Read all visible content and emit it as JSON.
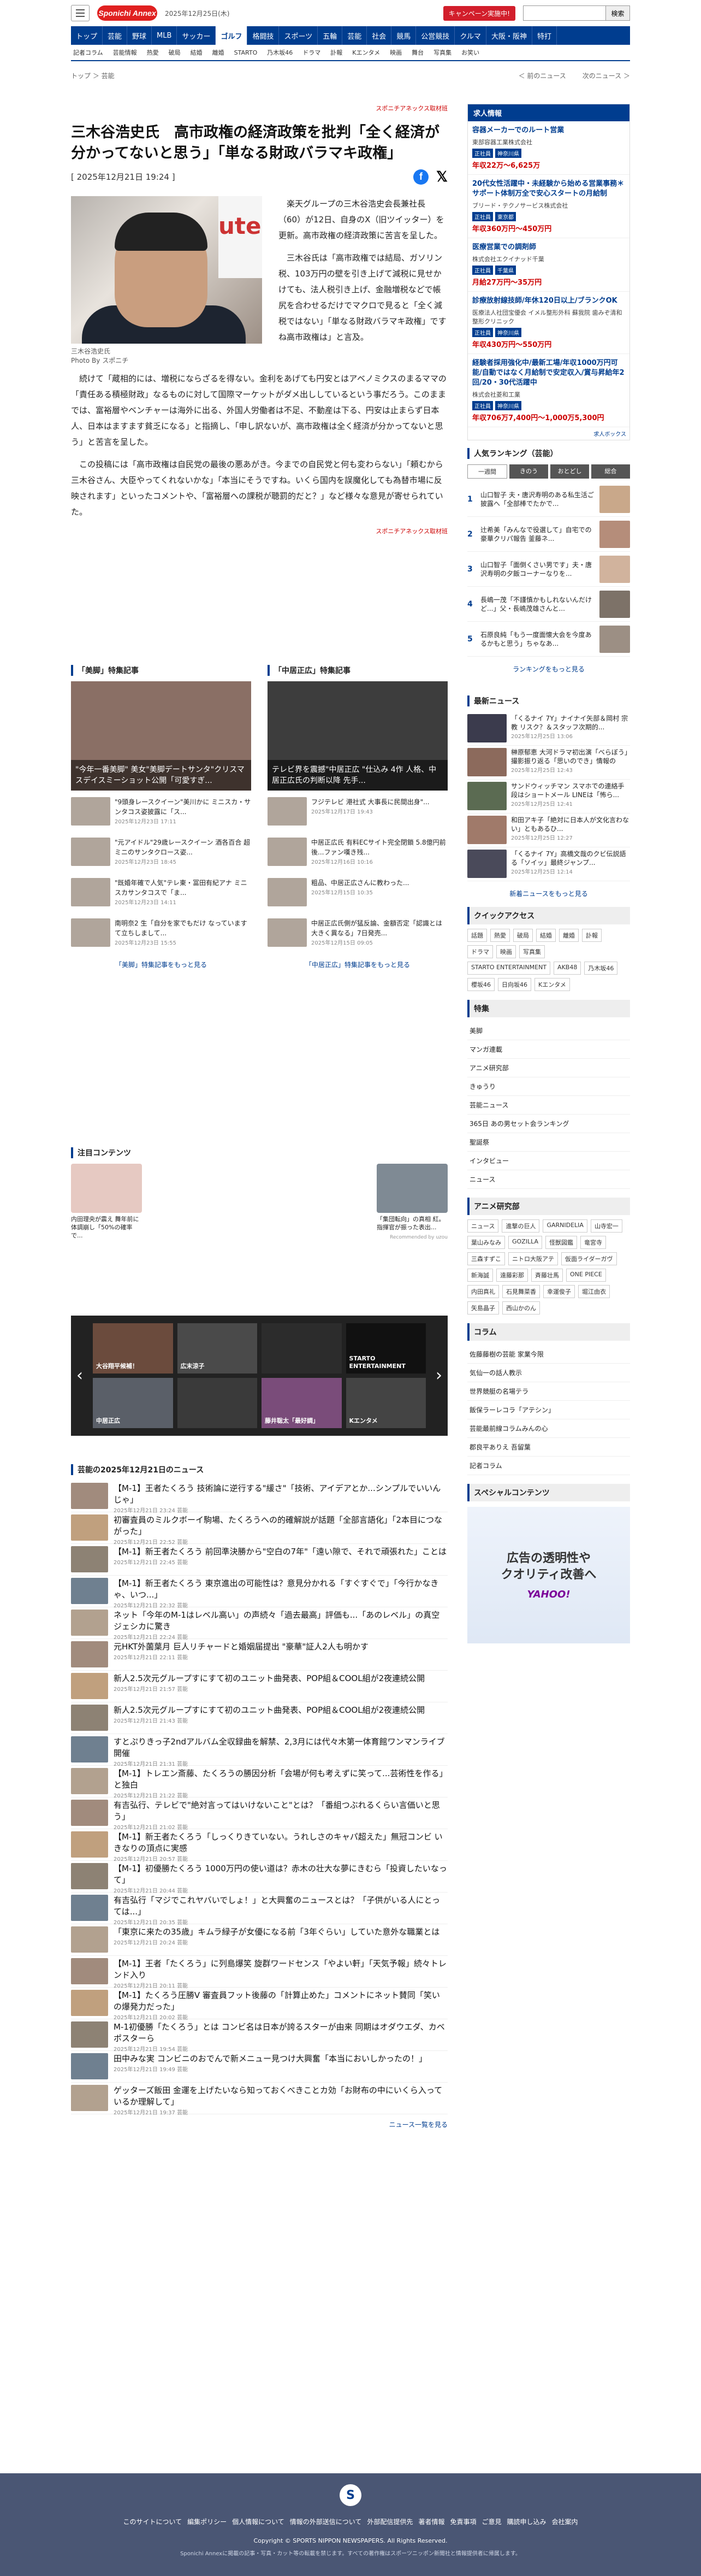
{
  "header": {
    "date": "2025年12月25日(木)",
    "campaign": "キャンペーン実施中!",
    "search_placeholder": "",
    "search_button": "検索",
    "logo": "Sponichi Annex"
  },
  "gnav": [
    "トップ",
    "芸能",
    "野球",
    "MLB",
    "サッカー",
    "ゴルフ",
    "格闘技",
    "スポーツ",
    "五輪",
    "芸能",
    "社会",
    "競馬",
    "公営競技",
    "クルマ",
    "大阪・阪神",
    "特打"
  ],
  "gnav_active": 5,
  "subnav": [
    "記者コラム",
    "芸能情報",
    "热愛",
    "破局",
    "結婚",
    "離婚",
    "STARTO",
    "乃木坂46",
    "ドラマ",
    "訃報",
    "Kエンタメ",
    "映画",
    "舞台",
    "写真集",
    "お笑い"
  ],
  "breadcrumb": "トップ ＞ 芸能",
  "pager": {
    "prev": "＜ 前のニュース",
    "next": "次のニュース ＞"
  },
  "article": {
    "pr_label": "スポニチアネックス取材班",
    "title": "三木谷浩史氏　高市政権の経済政策を批判「全く経済が分かってないと思う」「単なる財政バラマキ政権」",
    "date": "[ 2025年12月21日 19:24 ]",
    "photo_caption": "三木谷浩史氏\nPhoto By スポニチ",
    "p1": "楽天グループの三木谷浩史会長兼社長（60）が12日、自身のX（旧ツイッター）を更新。高市政権の経済政策に苦言を呈した。",
    "p2": "三木谷氏は「高市政権では結局、ガソリン税、103万円の壁を引き上げて減税に見せかけても、法人税引き上げ、金融増税などで帳尻を合わせるだけでマクロで見ると「全く減税ではない」「単なる財政バラマキ政権」ですね高市政権は」と言及。",
    "p3": "続けて「蔵相的には、増税にならざるを得ない。金利をあげても円安とはアベノミクスのまるママの「責任ある積極財政」なるものに対して国際マーケットがダメ出ししているという事だろう。このままでは、富裕層やベンチャーは海外に出る、外国人労働者は不足、不動産は下る、円安は止まらず日本人、日本はますます貧乏になる」と指摘し、「申し訳ないが、高市政権は全く経済が分かってないと思う」と苦言を呈した。",
    "p4": "この投稿には「高市政権は自民党の最後の悪あがき。今までの自民党と何も変わらない」「頼むから三木谷さん、大臣やってくれないかな」「本当にそうですね。いくら国内を誤魔化しても為替市場に反映されます」といったコメントや、「富裕層への課税が聴罰的だと？」など様々な意見が寄せられていた。",
    "pr_label2": "スポニチアネックス取材班"
  },
  "specials": [
    {
      "title": "「美脚」特集記事",
      "hero": "\"今年一番美脚\" 美女\"美脚デートサンタ\"クリスマスデイスミーショット公開「可愛すぎ...",
      "hero_date": "2025年12月24日 14:13",
      "items": [
        {
          "t": "\"9頭身レースクイーン\"美川かに ミニスカ・サンタコス姿披露に「ス...",
          "d": "2025年12月23日 17:11"
        },
        {
          "t": "\"元アイドル\"29歳レースクイーン 酒各百合 超ミニのサンタクロース姿...",
          "d": "2025年12月23日 18:45"
        },
        {
          "t": "\"既婚年確で人気\"テレ東・冨田有紀アナ ミニスカサンタコスで「ま...",
          "d": "2025年12月23日 14:11"
        },
        {
          "t": "南明奈2 生「自分を家でもだけ なっていますて立ちしまして...",
          "d": "2025年12月23日 15:55"
        }
      ],
      "more": "「美脚」特集記事をもっと見る"
    },
    {
      "title": "「中居正広」特集記事",
      "hero": "テレビ界を震撼\"中居正広 \"仕込み 4作 人格、中居正広氏の判断以降 先手...",
      "hero_date": "2025年12月21日 06:43",
      "items": [
        {
          "t": "フジテレビ 港社式 大事長に民間出身\"...",
          "d": "2025年12月17日 19:43"
        },
        {
          "t": "中居正広氏 有料ECサイト完全閉鎖 5.8億円前後...ファン嘆き残...",
          "d": "2025年12月16日 10:16"
        },
        {
          "t": "粗品、中居正広さんに教わった...",
          "d": "2025年12月15日 10:35"
        },
        {
          "t": "中居正広氏側が猛反論、金額否定「認識とは大きく異なる」7日発売...",
          "d": "2025年12月15日 09:05"
        }
      ],
      "more": "「中居正広」特集記事をもっと見る"
    }
  ],
  "attention": {
    "title": "注目コンテンツ",
    "items": [
      {
        "t": "内田理央が震え 舞年前に体調崩し「50%の確率で..."
      },
      {
        "t": ""
      },
      {
        "t": ""
      },
      {
        "t": ""
      },
      {
        "t": "「集団転向」の真相 紅。指揮官が振った表出...",
        "r": "Recommended by uzou"
      }
    ]
  },
  "carousel": {
    "cells": [
      "大谷翔平候補！",
      "広末涼子",
      "",
      "STARTO ENTERTAINMENT",
      "中居正広",
      "",
      "藤井聡太「最好調」",
      "Kエンタメ"
    ]
  },
  "newslist": {
    "title": "芸能の2025年12月21日のニュース",
    "items": [
      {
        "t": "【M-1】王者たくろう 技術論に逆行する\"緩さ\"「技術、アイデアとか...シンプルでいいんじゃ」",
        "d": "2025年12月21日 23:24 芸能"
      },
      {
        "t": "初審査員のミルクボーイ駒場、たくろうへの的確解説が話題「全部言語化」「2本目につながった」",
        "d": "2025年12月21日 22:52 芸能"
      },
      {
        "t": "【M-1】新王者たくろう 前回準決勝から\"空白の7年\"「遠い隙で、それで頑張れた」ことは",
        "d": "2025年12月21日 22:45 芸能"
      },
      {
        "t": "【M-1】新王者たくろう 東京進出の可能性は？意見分かれる「すぐすぐで」「今行かなきゃ、いつ...」",
        "d": "2025年12月21日 22:32 芸能"
      },
      {
        "t": "ネット「今年のM-1はレベル高い」の声続々「過去最高」評価も...「あのレベル」の真空ジェシカに驚き",
        "d": "2025年12月21日 22:24 芸能"
      },
      {
        "t": "元HKT外薗葉月 巨人リチャードと婚姻届提出 \"豪華\"証人2人も明かす",
        "d": "2025年12月21日 22:11 芸能"
      },
      {
        "t": "新人2.5次元グループすにすて初のユニット曲発表、POP組＆COOL組が2夜連続公開",
        "d": "2025年12月21日 21:57 芸能"
      },
      {
        "t": "新人2.5次元グループすにすて初のユニット曲発表、POP組＆COOL組が2夜連続公開",
        "d": "2025年12月21日 21:43 芸能"
      },
      {
        "t": "すとぷりきっ子2ndアルバム全収録曲を解禁、2,3月には代々木第一体育館ワンマンライブ開催",
        "d": "2025年12月21日 21:31 芸能"
      },
      {
        "t": "【M-1】トレエン斎藤、たくろうの勝因分析「会場が何も考えずに笑って...芸術性を作る」と独白",
        "d": "2025年12月21日 21:22 芸能"
      },
      {
        "t": "有吉弘行、テレビで\"絶対言ってはいけないこと\"とは？「番組つぶれるくらい言価いと思う」",
        "d": "2025年12月21日 21:02 芸能"
      },
      {
        "t": "【M-1】新王者たくろう「しっくりきていない。うれしさのキャパ超えた」無冠コンビ いきなりの頂点に実感",
        "d": "2025年12月21日 20:57 芸能"
      },
      {
        "t": "【M-1】初優勝たくろう 1000万円の使い道は？赤木の壮大な夢にきむら「投資したいなって」",
        "d": "2025年12月21日 20:44 芸能"
      },
      {
        "t": "有吉弘行「マジでこれヤバいでしょ！」と大興奮のニュースとは？「子供がいる人にとっては...」",
        "d": "2025年12月21日 20:35 芸能"
      },
      {
        "t": "「東京に来たの35歳」キムラ緑子が女優になる前「3年ぐらい」していた意外な職業とは",
        "d": "2025年12月21日 20:24 芸能"
      },
      {
        "t": "【M-1】王者「たくろう」に列島爆笑 旋群ワードセンス「やよい軒」「天気予報」続々トレンド入り",
        "d": "2025年12月21日 20:11 芸能"
      },
      {
        "t": "【M-1】たくろう圧勝V 審査員フット後藤の「計算止めた」コメントにネット賛同「笑いの爆発力だった」",
        "d": "2025年12月21日 20:02 芸能"
      },
      {
        "t": "M-1初優勝「たくろう」とは コンビ名は日本が誇るスターが由来 同期はオダウエダ、カベポスターら",
        "d": "2025年12月21日 19:54 芸能"
      },
      {
        "t": "田中みな実 コンビニのおでんで新メニュー見つけ大興奮「本当においしかったの！」",
        "d": "2025年12月21日 19:49 芸能"
      },
      {
        "t": "ゲッターズ飯田 金運を上げたいなら知っておくべきことカ効「お財布の中にいくら入っているか理解して」",
        "d": "2025年12月21日 19:37 芸能"
      }
    ],
    "more": "ニュース一覧を見る"
  },
  "side": {
    "jobs_title": "求人情報",
    "jobs": [
      {
        "t": "容器メーカーでのルート営業",
        "c": "東部容器工業株式会社",
        "tags": [
          "正社員",
          "神奈川県"
        ],
        "p": "年収22万～6,625万"
      },
      {
        "t": "20代女性活躍中・未経験から始める営業事務＊サポート体制万全で安心スタートの月給制",
        "c": "ブリード・テクノサービス株式会社",
        "tags": [
          "正社員",
          "東京都"
        ],
        "p": "年収360万円～450万円"
      },
      {
        "t": "医療営業での調剤師",
        "c": "株式会社エクイナッド千葉",
        "tags": [
          "正社員",
          "千葉県"
        ],
        "p": "月給27万円～35万円"
      },
      {
        "t": "診療放射線技師/年休120日以上/ブランクOK",
        "c": "医療法人社団宝優会 イメル整形外科 蘇我院 歯みぞ清和整形クリニック",
        "tags": [
          "正社員",
          "神奈川県"
        ],
        "p": "年収430万円～550万円"
      },
      {
        "t": "経験者採用強化中/最新工場/年収1000万円可能/自動ではなく月給制で安定収入/賞与昇給年2回/20・30代活躍中",
        "c": "株式会社菱和工業",
        "tags": [
          "正社員",
          "神奈川県"
        ],
        "p": "年収706万7,400円～1,000万5,300円"
      }
    ],
    "jobs_footer": "求人ボックス",
    "ranking_title": "人気ランキング（芸能）",
    "ranking_tabs": [
      "一週間",
      "きのう",
      "おとどし",
      "総合"
    ],
    "ranking": [
      {
        "n": "1",
        "t": "山口智子 夫・唐沢寿明のある私生活ご披露へ「全部棒でたかで..."
      },
      {
        "n": "2",
        "t": "辻希美「みんなで役選して」自宅での豪華クリパ報告 釜藤ネ..."
      },
      {
        "n": "3",
        "t": "山口智子「面倒くさい男です」夫・唐沢寿明の夕飯コーナーなりを..."
      },
      {
        "n": "4",
        "t": "長嶋一茂「不謹慎かもしれないんだけど...」父・長嶋茂雄さんと..."
      },
      {
        "n": "5",
        "t": "石原良純「もう一度面懐大会を今度あるかもと思う」ちゃなあ..."
      }
    ],
    "ranking_more": "ランキングをもっと見る",
    "latest_title": "最新ニュース",
    "latest": [
      {
        "t": "「くるナイ 7Y」ナイナイ矢部＆岡村 宗教 リスク？＆スタッフ次期的...",
        "d": "2025年12月25日 13:06"
      },
      {
        "t": "榊原郁恵 大河ドラマ初出演「べらぼう」撮影振り返る「思いのでき」情報の",
        "d": "2025年12月25日 12:43"
      },
      {
        "t": "サンドウィッチマン スマホでの連絡手段はショートメール LINEは「怖ら...",
        "d": "2025年12月25日 12:41"
      },
      {
        "t": "和田アキ子「絶対に日本人が文化言わない」ともあるひ...",
        "d": "2025年12月25日 12:27"
      },
      {
        "t": "「くるナイ 7Y」高橋文哉のクビ伝説語る「ソイッ」最終ジャンプ...",
        "d": "2025年12月25日 12:14"
      }
    ],
    "latest_more": "新着ニュースをもっと見る",
    "quick_title": "クイックアクセス",
    "quick": [
      "話題",
      "熱愛",
      "破局",
      "結婚",
      "離婚",
      "訃報",
      "ドラマ",
      "映画",
      "写真集",
      "STARTO ENTERTAINMENT",
      "AKB48",
      "乃木坂46",
      "櫻坂46",
      "日向坂46",
      "Kエンタメ"
    ],
    "feature_title": "特集",
    "feature": [
      "美脚",
      "マンガ連載",
      "アニメ研究部",
      "きゅうり",
      "芸能ニュース",
      "365日 あの男セット会ランキング",
      "聖誕祭",
      "インタビュー",
      "ニュース"
    ],
    "anime_title": "アニメ研究部",
    "anime": [
      "ニュース",
      "進撃の巨人",
      "GARNIDELIA",
      "山寺宏一",
      "葉山みなみ",
      "GOZILLA",
      "怪獣図鑑",
      "竜宮寺",
      "三森すずこ",
      "ニトロ大阪アテ",
      "仮面ライダーガヴ",
      "新海誠",
      "遠藤彩那",
      "斉藤壮馬",
      "ONE PIECE",
      "内田真礼",
      "石見舞菜香",
      "幸運俊子",
      "堀江由衣",
      "矢島晶子",
      "西山かのん"
    ],
    "column_title": "コラム",
    "column": [
      "佐藤藤樹の芸能 家業今限",
      "気仙一の話人教示",
      "世界競艇の名場テラ",
      "飯保ラーレコラ「アテシン」",
      "芸能最前線コラムみんの心",
      "郡良平ありえ 吾留葉",
      "記者コラム"
    ],
    "special_title": "スペシャルコンテンツ",
    "ad_text": "広告の透明性や\nクオリティ改善へ",
    "ad_brand": "YAHOO!"
  },
  "footer": {
    "links": [
      "このサイトについて",
      "編集ポリシー",
      "個人情報について",
      "情報の外部送信について",
      "外部配信提供先",
      "著者情報",
      "免責事項",
      "ご意見",
      "購読申し込み",
      "会社案内"
    ],
    "copy": "Copyright © SPORTS NIPPON NEWSPAPERS. All Rights Reserved.",
    "note": "Sponichi Annexに掲載の記事・写真・カット等の転載を禁じます。すべての著作権はスポーツニッポン新聞社と情報提供者に帰属します。"
  }
}
